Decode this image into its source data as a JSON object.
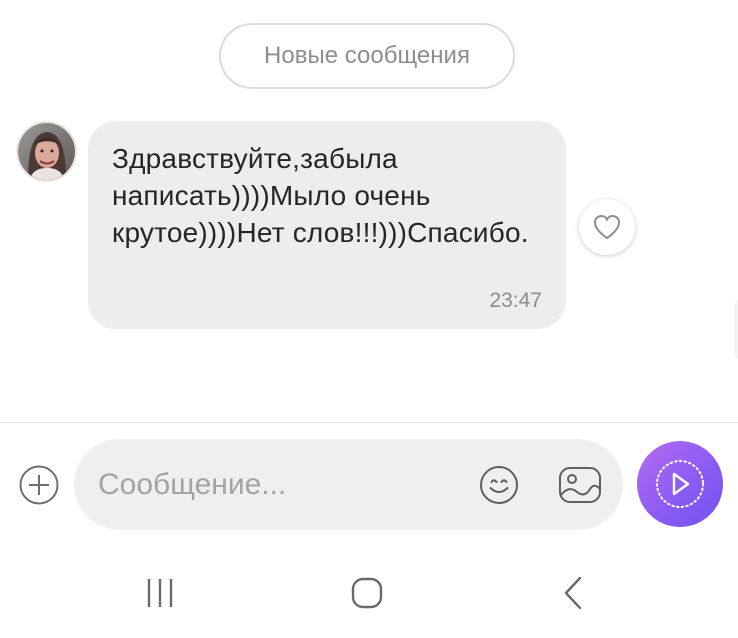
{
  "chat": {
    "new_messages_label": "Новые сообщения",
    "message": {
      "text": "Здравствуйте,забыла написать))))Мыло очень крутое))))Нет слов!!!)))Спасибо.",
      "time": "23:47"
    }
  },
  "composer": {
    "placeholder": "Сообщение...",
    "send_button_color": "#8b5cf4"
  },
  "icons": {
    "add": "plus-circle-icon",
    "emoji": "smiley-icon",
    "gallery": "gallery-icon",
    "send": "send-icon",
    "like": "heart-icon"
  },
  "navigation": {
    "items": [
      "recent-apps",
      "home",
      "back"
    ]
  }
}
